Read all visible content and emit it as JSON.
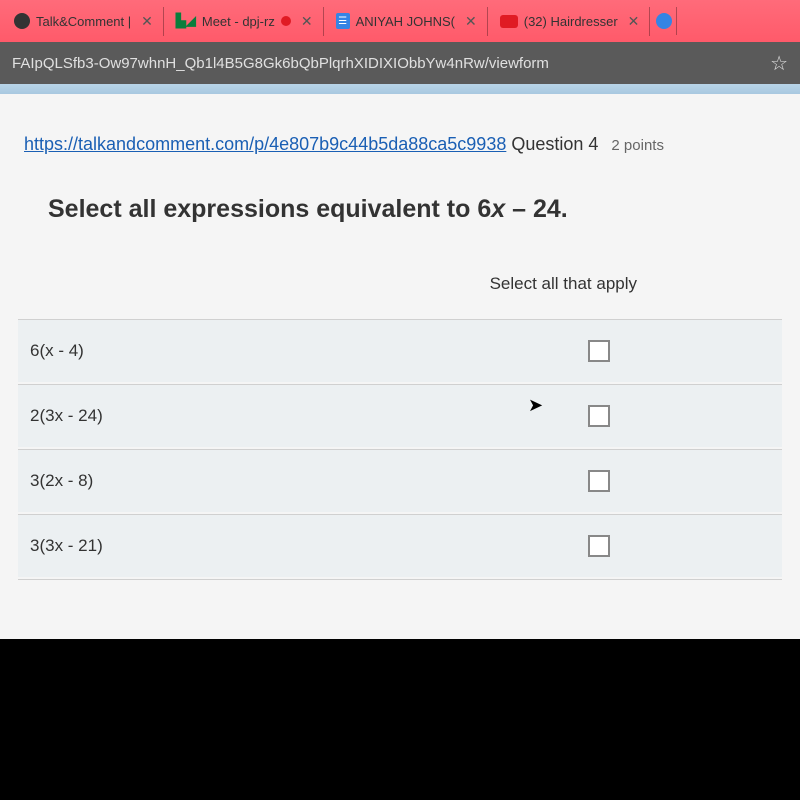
{
  "browser": {
    "tabs": [
      {
        "label": "Talk&Comment |",
        "close": "✕"
      },
      {
        "label": "Meet - dpj-rz",
        "close": "✕"
      },
      {
        "label": "ANIYAH JOHNS(",
        "close": "✕"
      },
      {
        "label": "(32) Hairdresser",
        "close": "✕"
      }
    ],
    "url": "FAIpQLSfb3-Ow97whnH_Qb1l4B5G8Gk6bQbPlqrhXIDIXIObbYw4nRw/viewform"
  },
  "question": {
    "link": "https://talkandcomment.com/p/4e807b9c44b5da88ca5c9938",
    "label": " Question 4",
    "points": "2 points",
    "prompt_prefix": "Select ",
    "prompt_bold": "all",
    "prompt_suffix": " expressions equivalent to 6",
    "prompt_var": "x",
    "prompt_end": " – 24.",
    "select_label": "Select all that apply",
    "options": [
      {
        "text": "6(x - 4)"
      },
      {
        "text": "2(3x - 24)"
      },
      {
        "text": "3(2x - 8)"
      },
      {
        "text": "3(3x - 21)"
      }
    ]
  }
}
